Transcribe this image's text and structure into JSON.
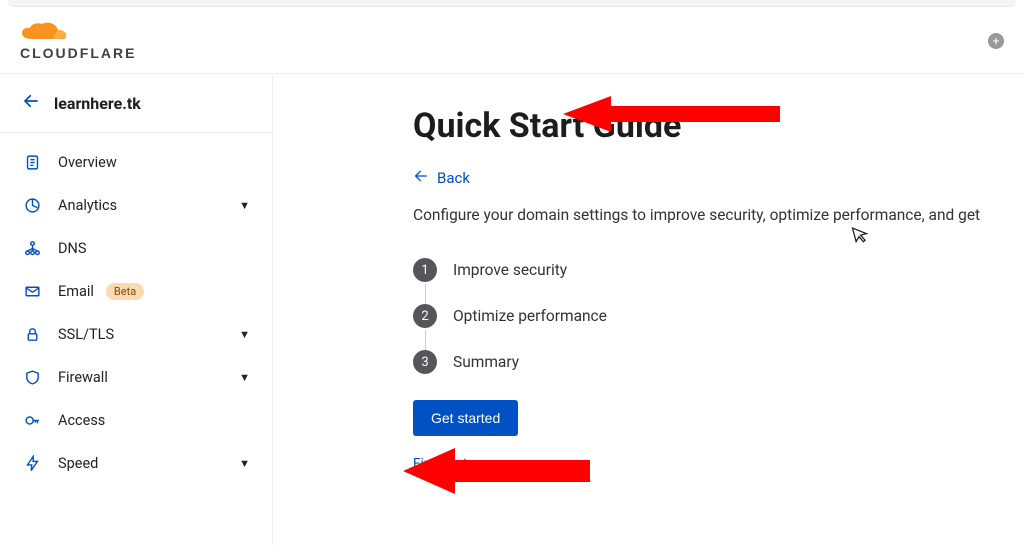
{
  "header": {
    "brand": "CLOUDFLARE"
  },
  "domain": {
    "name": "learnhere.tk"
  },
  "sidebar": {
    "items": [
      {
        "label": "Overview",
        "expandable": false
      },
      {
        "label": "Analytics",
        "expandable": true
      },
      {
        "label": "DNS",
        "expandable": false
      },
      {
        "label": "Email",
        "expandable": false,
        "badge": "Beta"
      },
      {
        "label": "SSL/TLS",
        "expandable": true
      },
      {
        "label": "Firewall",
        "expandable": true
      },
      {
        "label": "Access",
        "expandable": false
      },
      {
        "label": "Speed",
        "expandable": true
      }
    ]
  },
  "main": {
    "title": "Quick Start Guide",
    "back_label": "Back",
    "description": "Configure your domain settings to improve security, optimize performance, and get",
    "steps": [
      "Improve security",
      "Optimize performance",
      "Summary"
    ],
    "get_started_label": "Get started",
    "finish_later_label": "Finish later"
  }
}
